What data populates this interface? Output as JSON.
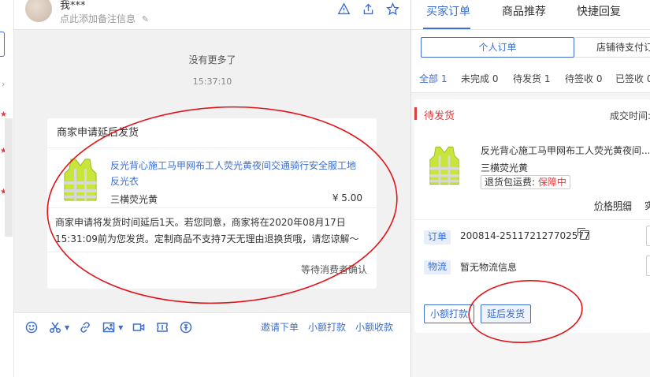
{
  "chat": {
    "user_name": "我***",
    "note_placeholder": "点此添加备注信息",
    "no_more": "没有更多了",
    "time": "15:37:10",
    "card": {
      "title": "商家申请延后发货",
      "product_name": "反光背心施工马甲网布工人荧光黄夜间交通骑行安全服工地反光衣",
      "sku": "三横荧光黄",
      "price": "¥ 5.00",
      "message": "商家申请将发货时间延后1天。若您同意，商家将在2020年08月17日 15:31:09前为您发货。定制商品不支持7天无理由退换货哦，请您谅解～",
      "footer": "等待消费者确认"
    },
    "toolbar_links": [
      "邀请下单",
      "小额打款",
      "小额收款"
    ],
    "toolbar_icons": [
      "emoji-icon",
      "scissors-icon",
      "link-icon",
      "image-icon",
      "video-icon",
      "ticket-icon",
      "coupon-icon"
    ]
  },
  "right": {
    "tabs": [
      "买家订单",
      "商品推荐",
      "快捷回复"
    ],
    "subtabs": [
      "个人订单",
      "店铺待支付订"
    ],
    "filters": [
      "全部 1",
      "未完成 0",
      "待发货 1",
      "待签收 0",
      "已签收 0"
    ],
    "order": {
      "status": "待发货",
      "deal_time_label": "成交时间:",
      "product_name": "反光背心施工马甲网布工人荧光黄夜间...",
      "sku": "三横荧光黄",
      "insurance_label": "退货包运费:",
      "insurance_value": "保障中",
      "price_detail": "价格明细",
      "price_detail_extra": "实",
      "order_label": "订单",
      "order_no": "200814-251172127702577",
      "logistics_label": "物流",
      "logistics_text": "暂无物流信息",
      "btn_small_pay": "小额打款",
      "btn_delay": "延后发货"
    }
  },
  "colors": {
    "accent": "#3c6fd1",
    "alert": "#e23b3b",
    "annotation": "#e0141a"
  }
}
